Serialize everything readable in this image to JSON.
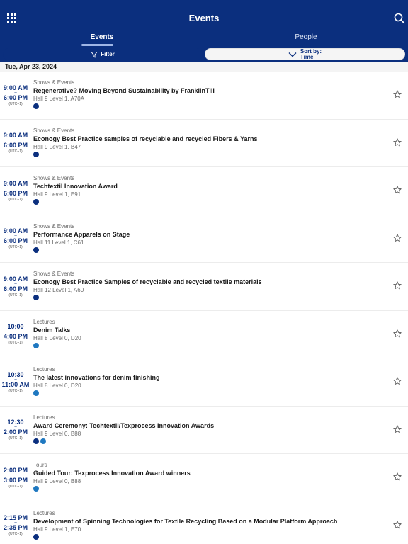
{
  "header": {
    "title": "Events",
    "menu_icon": "grid-icon",
    "search_icon": "search-icon"
  },
  "tabs": [
    {
      "label": "Events",
      "active": true
    },
    {
      "label": "People",
      "active": false
    }
  ],
  "toolbar": {
    "filter_label": "Filter",
    "sort_label": "Sort by:",
    "sort_value": "Time"
  },
  "date": "Tue, Apr 23, 2024",
  "colors": {
    "brand": "#0b2f7e",
    "dot_dark": "#0b2f7e",
    "dot_light": "#1f78c0"
  },
  "events": [
    {
      "start": "9:00 AM",
      "end": "6:00 PM",
      "tz": "(UTC+1)",
      "category": "Shows & Events",
      "title": "Regenerative? Moving Beyond Sustainability by FranklinTill",
      "location": "Hall 9 Level 1, A70A",
      "dots": [
        "dark"
      ]
    },
    {
      "start": "9:00 AM",
      "end": "6:00 PM",
      "tz": "(UTC+1)",
      "category": "Shows & Events",
      "title": "Econogy Best Practice samples of recyclable and recycled Fibers & Yarns",
      "location": "Hall 9 Level 1, B47",
      "dots": [
        "dark"
      ]
    },
    {
      "start": "9:00 AM",
      "end": "6:00 PM",
      "tz": "(UTC+1)",
      "category": "Shows & Events",
      "title": "Techtextil Innovation Award",
      "location": "Hall 9 Level 1, E91",
      "dots": [
        "dark"
      ]
    },
    {
      "start": "9:00 AM",
      "end": "6:00 PM",
      "tz": "(UTC+1)",
      "category": "Shows & Events",
      "title": "Performance Apparels on Stage",
      "location": "Hall 11 Level 1, C61",
      "dots": [
        "dark"
      ]
    },
    {
      "start": "9:00 AM",
      "end": "6:00 PM",
      "tz": "(UTC+1)",
      "category": "Shows & Events",
      "title": "Econogy Best Practice Samples of recyclable and recycled textile materials",
      "location": "Hall 12 Level 1, A60",
      "dots": [
        "dark"
      ]
    },
    {
      "start": "10:00",
      "end": "4:00 PM",
      "tz": "(UTC+1)",
      "category": "Lectures",
      "title": "Denim Talks",
      "location": "Hall 8 Level 0, D20",
      "dots": [
        "light"
      ]
    },
    {
      "start": "10:30",
      "end": "11:00 AM",
      "tz": "(UTC+1)",
      "category": "Lectures",
      "title": "The latest innovations for denim finishing",
      "location": "Hall 8 Level 0, D20",
      "dots": [
        "light"
      ]
    },
    {
      "start": "12:30",
      "end": "2:00 PM",
      "tz": "(UTC+1)",
      "category": "Lectures",
      "title": "Award Ceremony: Techtextil/Texprocess Innovation Awards",
      "location": "Hall 9 Level 0, B88",
      "dots": [
        "dark",
        "light"
      ]
    },
    {
      "start": "2:00 PM",
      "end": "3:00 PM",
      "tz": "(UTC+1)",
      "category": "Tours",
      "title": "Guided Tour: Texprocess Innovation Award winners",
      "location": "Hall 9 Level 0, B88",
      "dots": [
        "light"
      ]
    },
    {
      "start": "2:15 PM",
      "end": "2:35 PM",
      "tz": "(UTC+1)",
      "category": "Lectures",
      "title": "Development of Spinning Technologies for Textile Recycling Based on a Modular Platform Approach",
      "location": "Hall 9 Level 1, E70",
      "dots": [
        "dark"
      ]
    }
  ]
}
